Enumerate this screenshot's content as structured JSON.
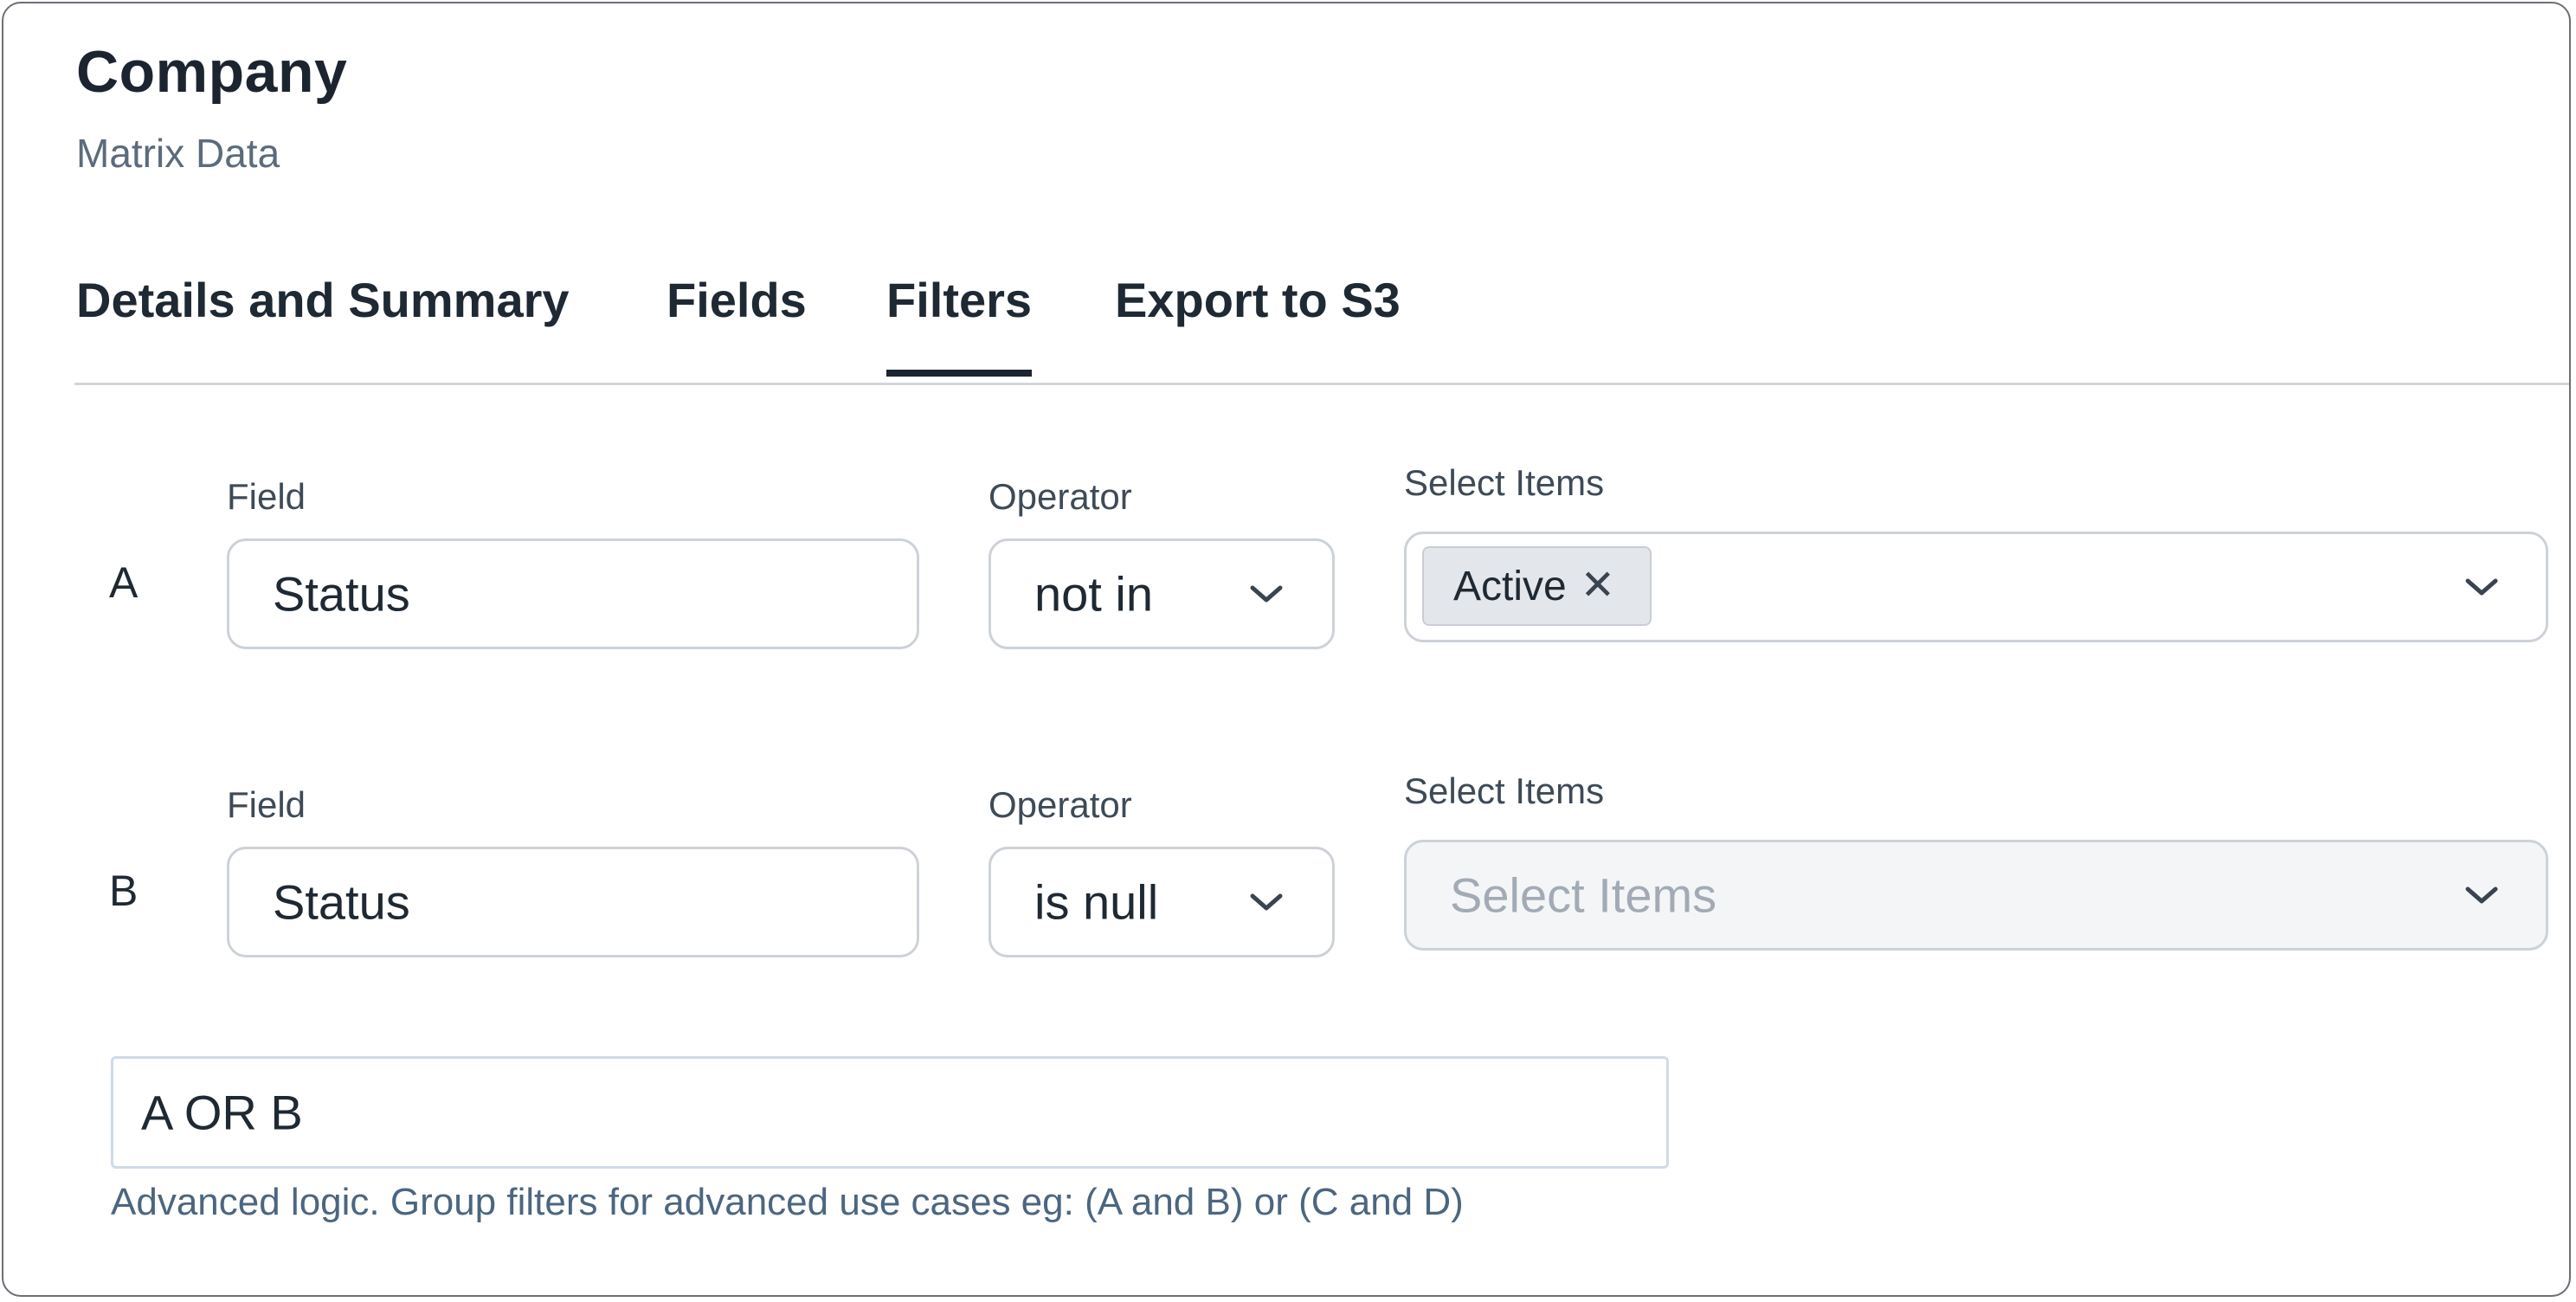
{
  "page": {
    "title": "Company",
    "subtitle": "Matrix Data"
  },
  "tabs": [
    {
      "label": "Details and Summary",
      "active": false
    },
    {
      "label": "Fields",
      "active": false
    },
    {
      "label": "Filters",
      "active": true
    },
    {
      "label": "Export to S3",
      "active": false
    }
  ],
  "filters": [
    {
      "letter": "A",
      "field_label": "Field",
      "field_value": "Status",
      "operator_label": "Operator",
      "operator_value": "not in",
      "items_label": "Select Items",
      "selected_items": [
        "Active"
      ],
      "items_placeholder": ""
    },
    {
      "letter": "B",
      "field_label": "Field",
      "field_value": "Status",
      "operator_label": "Operator",
      "operator_value": "is null",
      "items_label": "Select Items",
      "selected_items": [],
      "items_placeholder": "Select Items"
    }
  ],
  "advanced_logic": {
    "value": "A OR B",
    "help": "Advanced logic. Group filters for advanced use cases eg: (A and B) or (C and D)"
  },
  "icons": {
    "dropdown": "chevron-down-icon",
    "remove_tag": "close-icon"
  },
  "colors": {
    "active_tab_underline": "#1c2430",
    "help_text": "#4b6680"
  }
}
